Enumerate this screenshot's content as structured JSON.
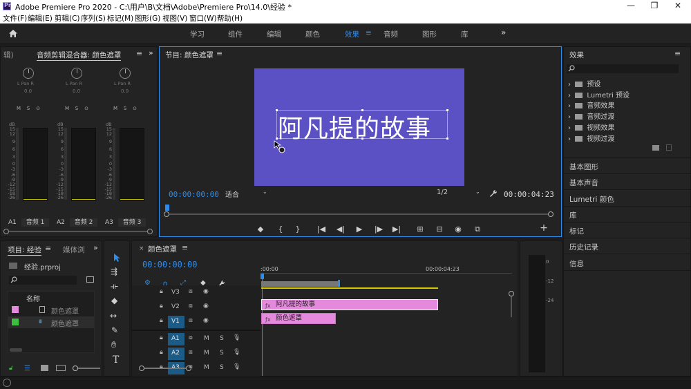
{
  "window": {
    "title": "Adobe Premiere Pro 2020 - C:\\用户\\B\\文档\\Adobe\\Premiere Pro\\14.0\\经验 *",
    "app_icon": "Pr"
  },
  "menu": [
    "文件(F)",
    "编辑(E)",
    "剪辑(C)",
    "序列(S)",
    "标记(M)",
    "图形(G)",
    "视图(V)",
    "窗口(W)",
    "帮助(H)"
  ],
  "workspaces": {
    "tabs": [
      "学习",
      "组件",
      "编辑",
      "颜色",
      "效果",
      "音频",
      "图形",
      "库"
    ],
    "active": "效果",
    "more": "»"
  },
  "mixer": {
    "left_tab": "辑)",
    "title": "音频剪辑混合器: 颜色遮罩",
    "pan_label": "L  Pan  R",
    "pan_value": "0.0",
    "buttons": [
      "M",
      "S",
      "⊙"
    ],
    "db_label": "dB",
    "db_scale": [
      "15",
      "12",
      "9",
      "6",
      "3",
      "0",
      "-3",
      "-6",
      "-9",
      "-12",
      "-15",
      "-18",
      "-22",
      "-26",
      "-∞"
    ],
    "channels": [
      {
        "id": "A1",
        "name": "音频 1"
      },
      {
        "id": "A2",
        "name": "音频 2"
      },
      {
        "id": "A3",
        "name": "音频 3"
      }
    ]
  },
  "program": {
    "title": "节目: 颜色遮罩",
    "title_text": "阿凡提的故事",
    "timecode_current": "00:00:00:00",
    "fit": "适合",
    "resolution": "1/2",
    "timecode_duration": "00:00:04:23",
    "controls": [
      "◆",
      "{",
      "}",
      "|◀",
      "◀|",
      "▶",
      "|▶",
      "▶|",
      "⊞",
      "⊟",
      "◉",
      "⧉"
    ],
    "add": "+"
  },
  "effects": {
    "title": "效果",
    "search_placeholder": "",
    "tree": [
      "预设",
      "Lumetri 预设",
      "音频效果",
      "音频过渡",
      "视频效果",
      "视频过渡"
    ],
    "sections": [
      "基本图形",
      "基本声音",
      "Lumetri 颜色",
      "库",
      "标记",
      "历史记录",
      "信息"
    ]
  },
  "project": {
    "title": "项目: 经验",
    "media_tab": "媒体浏",
    "file": "经验.prproj",
    "column_name": "名称",
    "items": [
      {
        "name": "颜色遮罩",
        "swatch": "#e589dd"
      },
      {
        "name": "颜色遮罩",
        "swatch": "#3fbf3f"
      }
    ]
  },
  "timeline": {
    "tab": "颜色遮罩",
    "timecode": "00:00:00:00",
    "ruler": [
      ":00:00",
      "00:00:04:23"
    ],
    "meter_scale": [
      "0",
      "-12",
      "-24"
    ],
    "tracks_video": [
      {
        "id": "V3",
        "name": "V3"
      },
      {
        "id": "V2",
        "name": "V2"
      },
      {
        "id": "V1",
        "name": "V1"
      }
    ],
    "tracks_audio": [
      {
        "id": "A1",
        "name": "A1"
      },
      {
        "id": "A2",
        "name": "A2"
      },
      {
        "id": "A3",
        "name": "A3"
      }
    ],
    "clips": [
      {
        "track": "V2",
        "name": "阿凡提的故事"
      },
      {
        "track": "V1",
        "name": "颜色遮罩"
      }
    ]
  },
  "colors": {
    "accent": "#2d8ceb",
    "frame": "#5b50c4",
    "clip": "#e589dd",
    "track_target": "#1d5b87"
  }
}
